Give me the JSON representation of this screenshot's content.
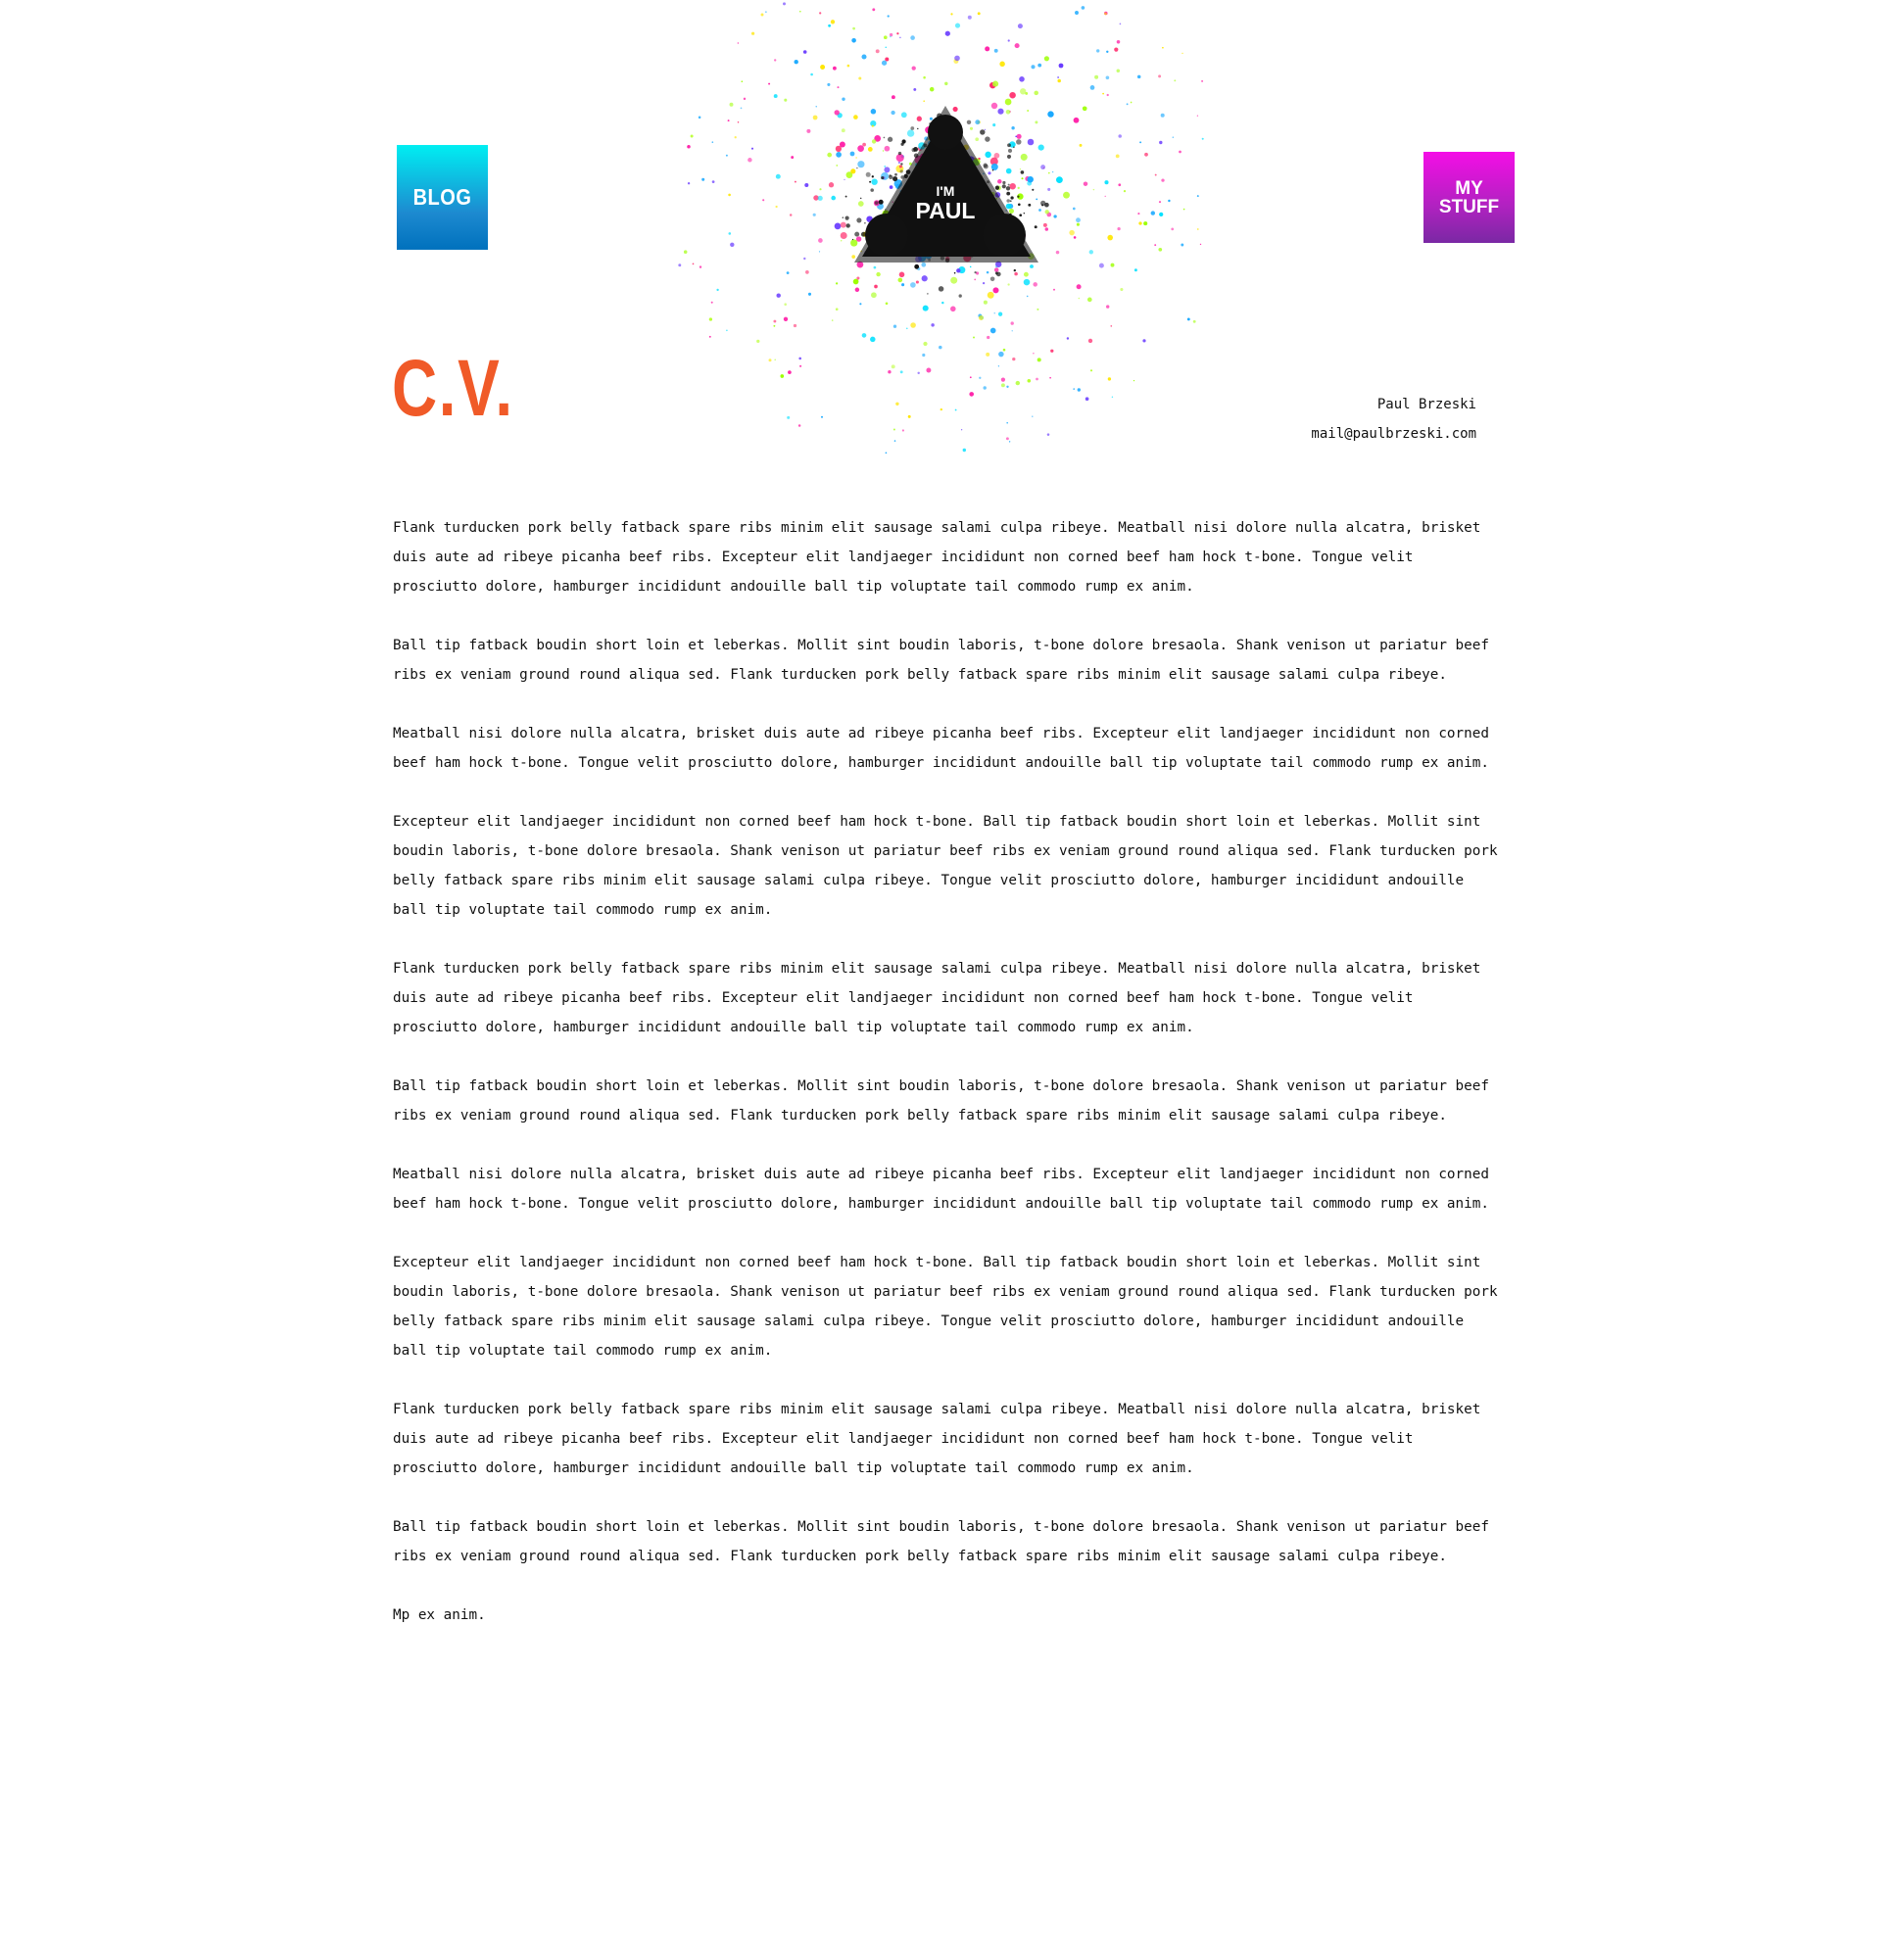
{
  "nav": {
    "blog_label": "Blog",
    "stuff_label_line1": "My",
    "stuff_label_line2": "Stuff"
  },
  "logo": {
    "small_text": "I'm",
    "big_text": "Paul"
  },
  "page": {
    "title": "C.V."
  },
  "contact": {
    "name": "Paul Brzeski",
    "email": "mail@paulbrzeski.com"
  },
  "paragraphs": [
    "Flank turducken pork belly fatback spare ribs minim elit sausage salami culpa ribeye. Meatball nisi dolore nulla alcatra, brisket duis aute ad ribeye picanha beef ribs. Excepteur elit landjaeger incididunt non corned beef ham hock t-bone. Tongue velit prosciutto dolore, hamburger incididunt andouille ball tip voluptate tail commodo rump ex anim.",
    "Ball tip fatback boudin short loin et leberkas. Mollit sint boudin laboris, t-bone dolore bresaola. Shank venison ut pariatur beef ribs ex veniam ground round aliqua sed. Flank turducken pork belly fatback spare ribs minim elit sausage salami culpa ribeye.",
    "Meatball nisi dolore nulla alcatra, brisket duis aute ad ribeye picanha beef ribs. Excepteur elit landjaeger incididunt non corned beef ham hock t-bone. Tongue velit prosciutto dolore, hamburger incididunt andouille ball tip voluptate tail commodo rump ex anim.",
    "Excepteur elit landjaeger incididunt non corned beef ham hock t-bone. Ball tip fatback boudin short loin et leberkas. Mollit sint boudin laboris, t-bone dolore bresaola. Shank venison ut pariatur beef ribs ex veniam ground round aliqua sed. Flank turducken pork belly fatback spare ribs minim elit sausage salami culpa ribeye. Tongue velit prosciutto dolore, hamburger incididunt andouille ball tip voluptate tail commodo rump ex anim.",
    "Flank turducken pork belly fatback spare ribs minim elit sausage salami culpa ribeye. Meatball nisi dolore nulla alcatra, brisket duis aute ad ribeye picanha beef ribs. Excepteur elit landjaeger incididunt non corned beef ham hock t-bone. Tongue velit prosciutto dolore, hamburger incididunt andouille ball tip voluptate tail commodo rump ex anim.",
    "Ball tip fatback boudin short loin et leberkas. Mollit sint boudin laboris, t-bone dolore bresaola. Shank venison ut pariatur beef ribs ex veniam ground round aliqua sed. Flank turducken pork belly fatback spare ribs minim elit sausage salami culpa ribeye.",
    "Meatball nisi dolore nulla alcatra, brisket duis aute ad ribeye picanha beef ribs. Excepteur elit landjaeger incididunt non corned beef ham hock t-bone. Tongue velit prosciutto dolore, hamburger incididunt andouille ball tip voluptate tail commodo rump ex anim.",
    "Excepteur elit landjaeger incididunt non corned beef ham hock t-bone. Ball tip fatback boudin short loin et leberkas. Mollit sint boudin laboris, t-bone dolore bresaola. Shank venison ut pariatur beef ribs ex veniam ground round aliqua sed. Flank turducken pork belly fatback spare ribs minim elit sausage salami culpa ribeye. Tongue velit prosciutto dolore, hamburger incididunt andouille ball tip voluptate tail commodo rump ex anim.",
    "Flank turducken pork belly fatback spare ribs minim elit sausage salami culpa ribeye. Meatball nisi dolore nulla alcatra, brisket duis aute ad ribeye picanha beef ribs. Excepteur elit landjaeger incididunt non corned beef ham hock t-bone. Tongue velit prosciutto dolore, hamburger incididunt andouille ball tip voluptate tail commodo rump ex anim.",
    "Ball tip fatback boudin short loin et leberkas. Mollit sint boudin laboris, t-bone dolore bresaola. Shank venison ut pariatur beef ribs ex veniam ground round aliqua sed. Flank turducken pork belly fatback spare ribs minim elit sausage salami culpa ribeye.",
    "Mp ex anim."
  ],
  "colors": {
    "title_orange": "#f05a28",
    "blog_cyan": "#00eef2",
    "blog_blue": "#0071bd",
    "stuff_magenta": "#f40ee6",
    "stuff_purple": "#7a28a4"
  }
}
